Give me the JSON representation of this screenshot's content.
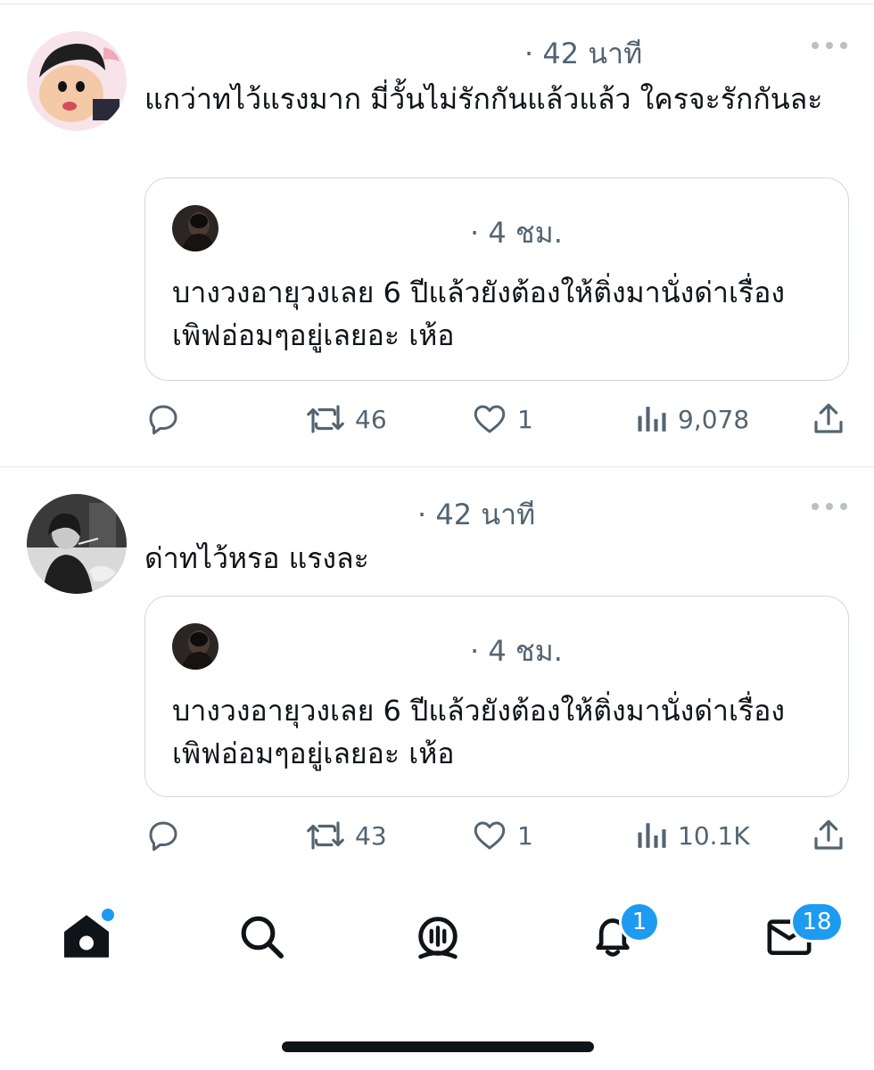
{
  "tweets": [
    {
      "time": "· 42 นาที",
      "text": "แกว่าทไว้แรงมาก มี่วั้นไม่รักกันแล้วแล้ว ใครจะรักกันละ",
      "avatar_icon": "cartoon-avatar",
      "quote": {
        "time": "· 4 ชม.",
        "text": "บางวงอายุวงเลย 6 ปีแล้วยังต้องให้ติ่งมานั่งด่าเรื่องเพิฟอ่อมๆอยู่เลยอะ เห้อ",
        "avatar_icon": "dark-avatar"
      },
      "actions": {
        "retweets": "46",
        "likes": "1",
        "views": "9,078"
      }
    },
    {
      "time": "· 42 นาที",
      "text": "ด่าทไว้หรอ แรงละ",
      "avatar_icon": "photo-avatar",
      "quote": {
        "time": "· 4 ชม.",
        "text": "บางวงอายุวงเลย 6 ปีแล้วยังต้องให้ติ่งมานั่งด่าเรื่องเพิฟอ่อมๆอยู่เลยอะ เห้อ",
        "avatar_icon": "dark-avatar"
      },
      "actions": {
        "retweets": "43",
        "likes": "1",
        "views": "10.1K"
      }
    }
  ],
  "bottom_nav": {
    "items": [
      "home-icon",
      "search-icon",
      "spaces-icon",
      "bell-icon",
      "mail-icon"
    ],
    "notifications_badge": "1",
    "messages_badge": "18"
  },
  "colors": {
    "accent": "#1d9bf0",
    "secondary_text": "#536471",
    "border": "#cfd9de"
  }
}
